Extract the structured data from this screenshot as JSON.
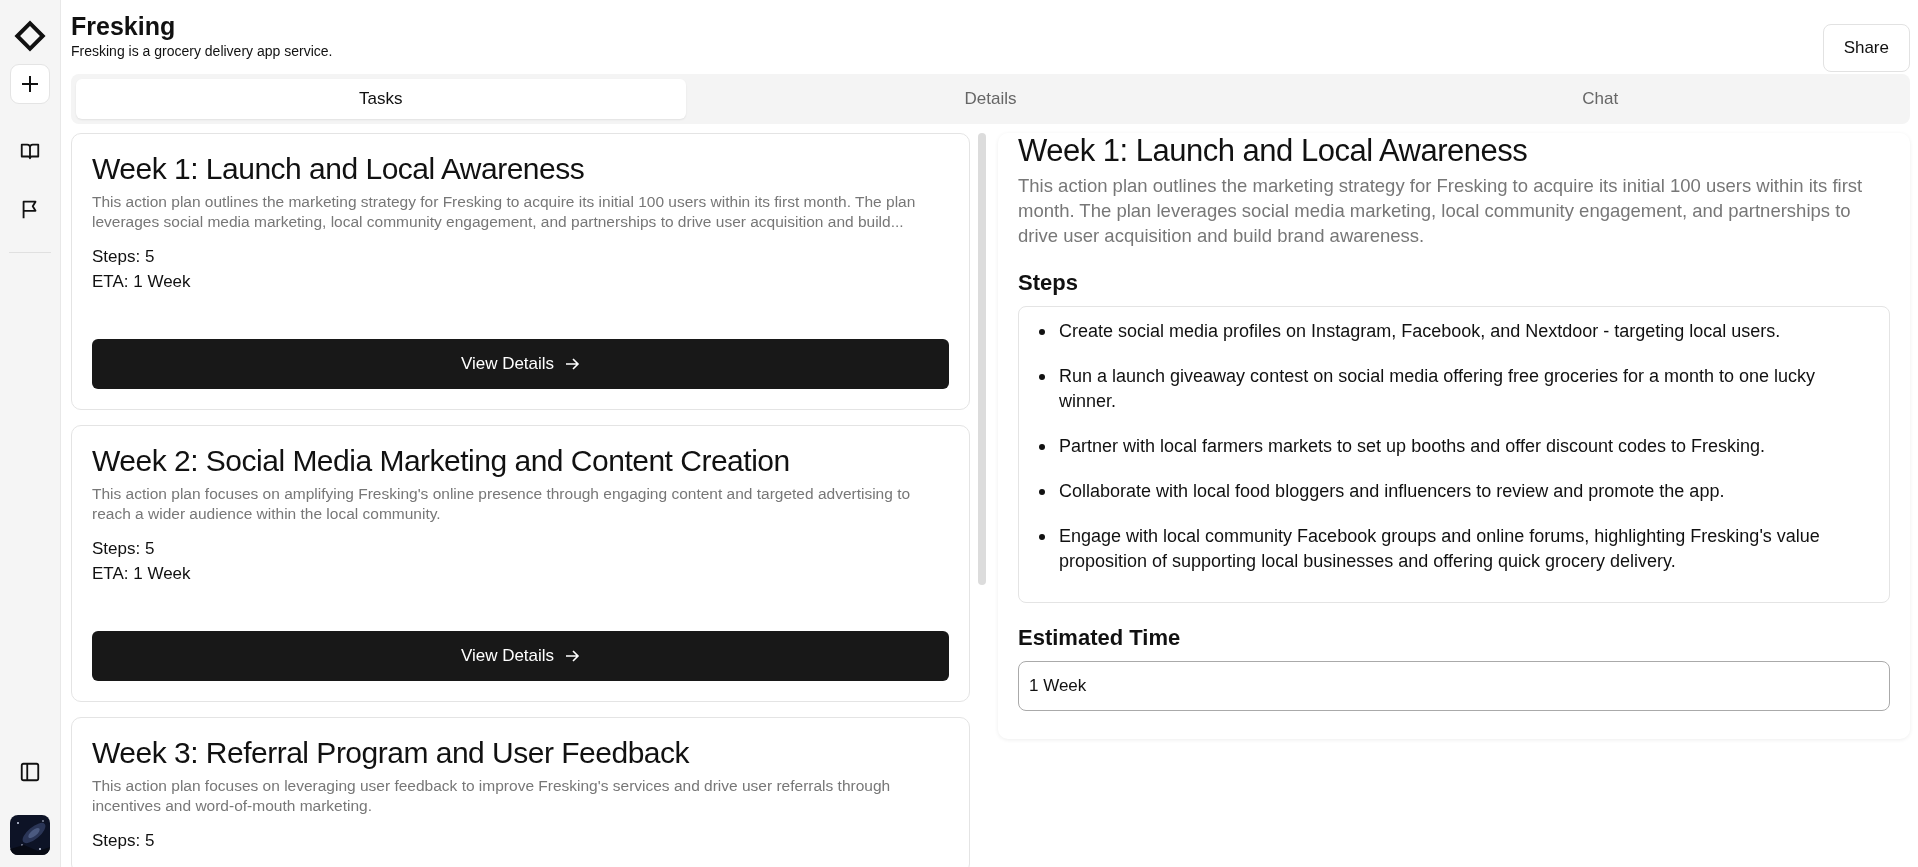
{
  "app": {
    "title": "Fresking",
    "subtitle": "Fresking is a grocery delivery app service.",
    "share_button": "Share"
  },
  "tabs": [
    {
      "label": "Tasks",
      "selected": true
    },
    {
      "label": "Details",
      "selected": false
    },
    {
      "label": "Chat",
      "selected": false
    }
  ],
  "plans": [
    {
      "title": "Week 1: Launch and Local Awareness",
      "description": "This action plan outlines the marketing strategy for Fresking to acquire its initial 100 users within its first month. The plan leverages social media marketing, local community engagement, and partnerships to drive user acquisition and build...",
      "steps": "Steps: 5",
      "eta": "ETA: 1 Week",
      "button": "View Details"
    },
    {
      "title": "Week 2: Social Media Marketing and Content Creation",
      "description": "This action plan focuses on amplifying Fresking's online presence through engaging content and targeted advertising to reach a wider audience within the local community.",
      "steps": "Steps: 5",
      "eta": "ETA: 1 Week",
      "button": "View Details"
    },
    {
      "title": "Week 3: Referral Program and User Feedback",
      "description": "This action plan focuses on leveraging user feedback to improve Fresking's services and drive user referrals through incentives and word-of-mouth marketing.",
      "steps": "Steps: 5"
    }
  ],
  "detail": {
    "title": "Week 1: Launch and Local Awareness",
    "description": "This action plan outlines the marketing strategy for Fresking to acquire its initial 100 users within its first month. The plan leverages social media marketing, local community engagement, and partnerships to drive user acquisition and build brand awareness.",
    "steps_heading": "Steps",
    "steps": [
      "Create social media profiles on Instagram, Facebook, and Nextdoor - targeting local users.",
      "Run a launch giveaway contest on social media offering free groceries for a month to one lucky winner.",
      "Partner with local farmers markets to set up booths and offer discount codes to Fresking.",
      "Collaborate with local food bloggers and influencers to review and promote the app.",
      "Engage with local community Facebook groups and online forums, highlighting Fresking's value proposition of supporting local businesses and offering quick grocery delivery."
    ],
    "time_heading": "Estimated Time",
    "time_value": "1 Week"
  }
}
